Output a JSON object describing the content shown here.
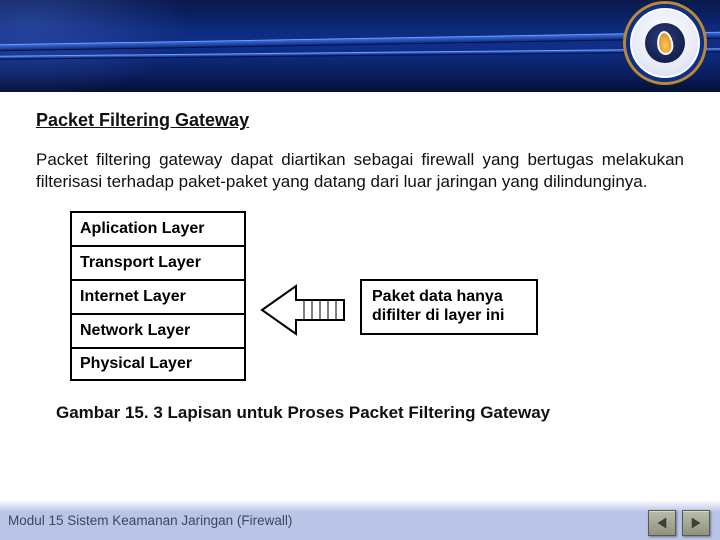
{
  "header": {
    "logo_name": "institution-logo"
  },
  "content": {
    "title": "Packet Filtering Gateway",
    "body": "Packet filtering gateway dapat diartikan sebagai firewall yang bertugas melakukan filterisasi terhadap paket-paket yang datang dari luar jaringan yang dilindunginya.",
    "layers": [
      "Aplication Layer",
      "Transport Layer",
      "Internet  Layer",
      "Network  Layer",
      "Physical Layer"
    ],
    "note": "Paket data hanya difilter di layer ini",
    "caption": "Gambar 15. 3 Lapisan untuk Proses Packet Filtering Gateway"
  },
  "footer": {
    "text": "Modul 15 Sistem Keamanan Jaringan (Firewall)"
  },
  "nav": {
    "prev": "previous-slide",
    "next": "next-slide"
  }
}
